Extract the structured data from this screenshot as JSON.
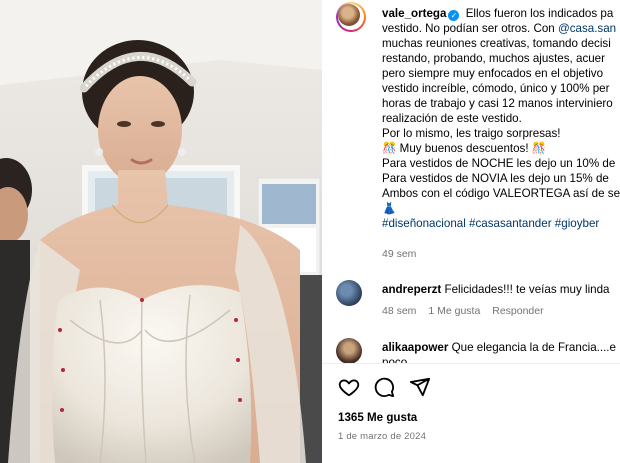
{
  "post": {
    "username": "vale_ortega",
    "caption_lines": [
      "Ellos fueron los indicados pa",
      "vestido. No podían ser otros. Con",
      "muchas reuniones creativas, tomando decisi",
      "restando, probando, muchos ajustes, acuer",
      "pero siempre muy enfocados en el objetivo",
      "vestido increíble, cómodo, único y 100% per",
      "horas de trabajo y casi 12 manos interviniero",
      "realización de este vestido.",
      "Por lo mismo, les traigo sorpresas!",
      "Muy buenos descuentos!",
      "Para vestidos de NOCHE les dejo un 10% de",
      "Para vestidos de NOVIA les dejo un 15% de",
      "Ambos con el código VALEORTEGA así de se"
    ],
    "mention": "@casa.san",
    "party_emoji": "🎊",
    "dress_emoji": "👗",
    "hashtags": [
      "#diseñonacional",
      "#casasantander",
      "#gioyber"
    ],
    "caption_time": "49 sem"
  },
  "comments": [
    {
      "username": "andreperzt",
      "text": "Felicidades!!! te veías muy linda",
      "time": "48 sem",
      "likes": "1 Me gusta",
      "reply": "Responder"
    },
    {
      "username": "alikaapower",
      "text": "Que elegancia la de Francia....e",
      "overflow": "poco"
    }
  ],
  "actions": {
    "like_icon": "heart-icon",
    "comment_icon": "comment-icon",
    "share_icon": "share-icon"
  },
  "likes_text": "1365 Me gusta",
  "date_text": "1 de marzo de 2024",
  "colors": {
    "link": "#00376b",
    "verified": "#0095f6",
    "meta": "#737373"
  }
}
